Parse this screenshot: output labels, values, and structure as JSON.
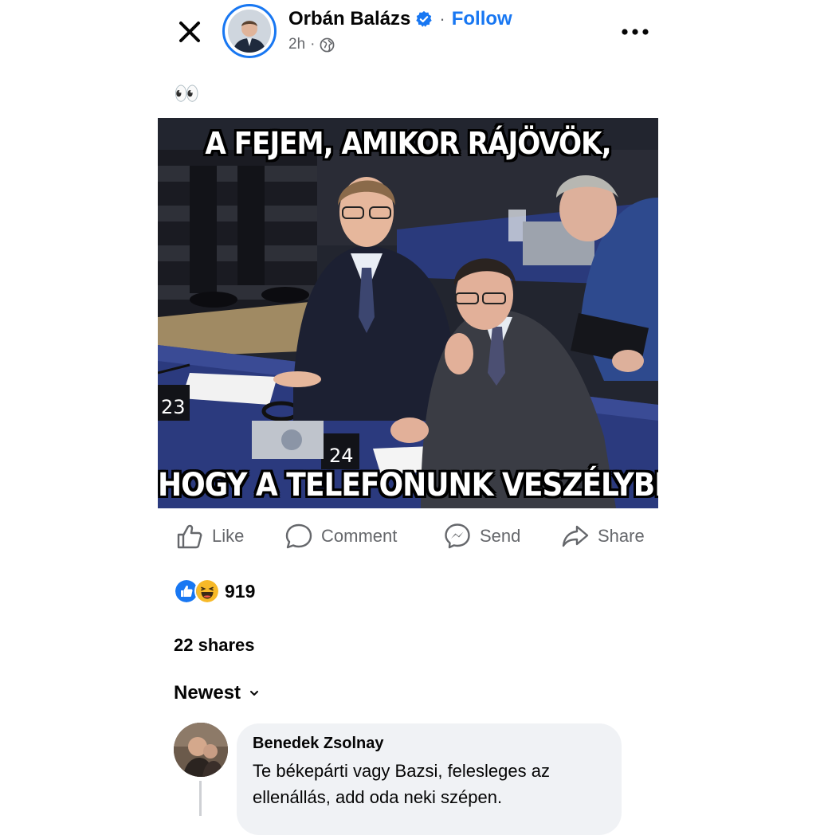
{
  "header": {
    "author_name": "Orbán Balázs",
    "separator": "·",
    "follow_label": "Follow",
    "time": "2h",
    "meta_separator": "·",
    "verified_color": "#1877f2",
    "privacy_icon": "globe-icon"
  },
  "post": {
    "text": "👀",
    "image": {
      "top_caption": "A FEJEM, AMIKOR RÁJÖVÖK,",
      "bottom_caption": "HOGY A TELEFONUNK VESZÉLYBEN",
      "seat_labels": [
        "23",
        "24"
      ]
    }
  },
  "actions": [
    {
      "label": "Like",
      "icon": "thumbs-up-icon"
    },
    {
      "label": "Comment",
      "icon": "comment-icon"
    },
    {
      "label": "Send",
      "icon": "messenger-icon"
    },
    {
      "label": "Share",
      "icon": "share-arrow-icon"
    }
  ],
  "reactions": {
    "types": [
      "like",
      "haha"
    ],
    "count": "919"
  },
  "shares_label": "22 shares",
  "sort_label": "Newest",
  "comments": [
    {
      "author": "Benedek Zsolnay",
      "text": "Te békepárti vagy Bazsi, felesleges az ellenállás, add oda neki szépen."
    }
  ],
  "colors": {
    "accent": "#1877f2",
    "secondary_text": "#65676b",
    "bubble_bg": "#f0f2f5",
    "haha_yellow": "#f7b928"
  }
}
